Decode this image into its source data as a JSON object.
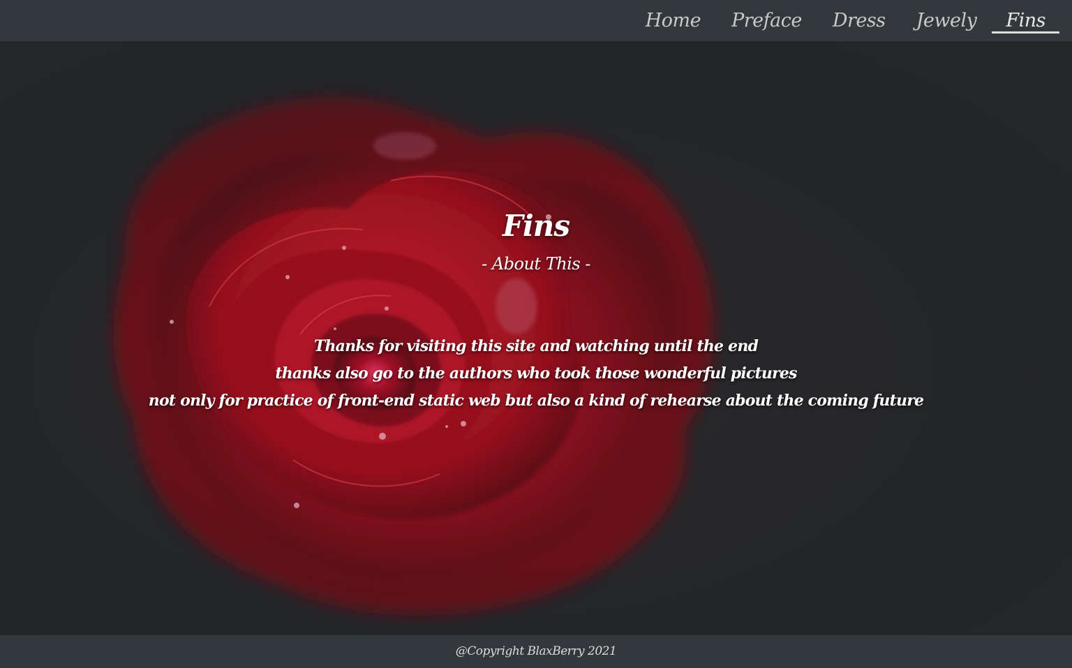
{
  "nav": {
    "items": [
      {
        "label": "Home"
      },
      {
        "label": "Preface"
      },
      {
        "label": "Dress"
      },
      {
        "label": "Jewely"
      },
      {
        "label": "Fins",
        "active": true
      }
    ]
  },
  "hero": {
    "image_icon": "red-rose-photo",
    "title": "Fins",
    "subtitle": "- About This -",
    "lines": [
      "Thanks for visiting this site and watching until the end",
      "thanks also go to the authors who took those wonderful pictures",
      "not only for practice of front-end static web but also a kind of rehearse about the coming future"
    ]
  },
  "footer": {
    "copyright": "@Copyright BlaxBerry 2021"
  },
  "colors": {
    "header_bg": "#33383c",
    "page_bg": "#2b2e31",
    "rose_red": "#b5121f",
    "text": "#ffffff"
  }
}
